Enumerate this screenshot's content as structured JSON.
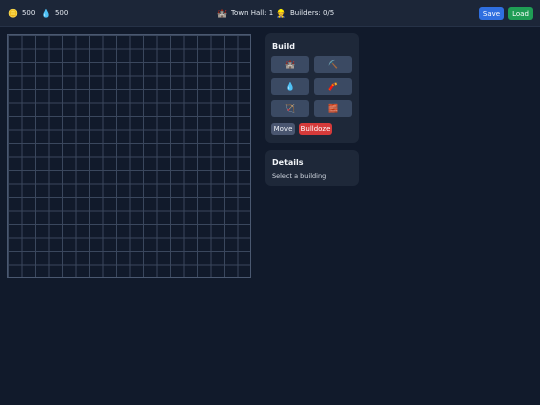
{
  "topbar": {
    "gold": {
      "icon": "gold-coin-icon",
      "glyph": "🪙",
      "value": "500"
    },
    "elixir": {
      "icon": "elixir-drop-icon",
      "glyph": "💧",
      "value": "500"
    },
    "town_hall": {
      "glyph": "🏰",
      "label": "Town Hall: 1"
    },
    "builders": {
      "glyph": "👷",
      "label": "Builders: 0/5"
    },
    "save_label": "Save",
    "load_label": "Load"
  },
  "build": {
    "title": "Build",
    "buttons": [
      {
        "name": "castle-icon",
        "glyph": "🏰"
      },
      {
        "name": "pickaxe-icon",
        "glyph": "⛏️"
      },
      {
        "name": "elixir-drop-icon",
        "glyph": "💧"
      },
      {
        "name": "dynamite-icon",
        "glyph": "🧨"
      },
      {
        "name": "bow-icon",
        "glyph": "🏹"
      },
      {
        "name": "brick-wall-icon",
        "glyph": "🧱"
      }
    ],
    "move_label": "Move",
    "bulldoze_label": "Bulldoze"
  },
  "details": {
    "title": "Details",
    "text": "Select a building"
  },
  "colors": {
    "background": "#111a2b",
    "save": "#2f6fe0",
    "load": "#1f9d55",
    "bulldoze": "#d63a3a"
  }
}
